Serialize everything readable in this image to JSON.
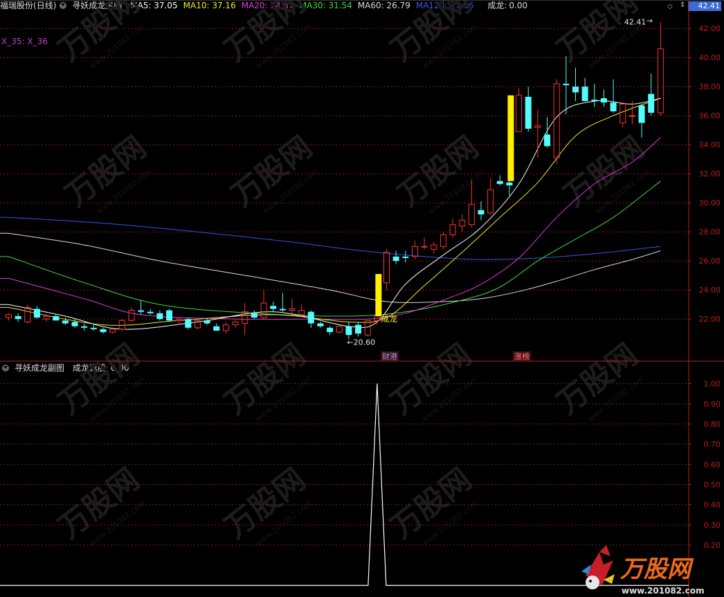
{
  "header": {
    "stock": "福瑞股份",
    "period": "(日线)",
    "indicator": "寻妖成龙主图",
    "ma": [
      {
        "label": "MA5:",
        "value": "37.05",
        "color": "#ffffff"
      },
      {
        "label": "MA10:",
        "value": "37.16",
        "color": "#f2ea2c"
      },
      {
        "label": "MA20:",
        "value": "34.57",
        "color": "#e03ae0"
      },
      {
        "label": "MA30:",
        "value": "31.54",
        "color": "#3edc3e"
      },
      {
        "label": "MA60:",
        "value": "26.79",
        "color": "#dddddd"
      },
      {
        "label": "MA120:",
        "value": "27.06",
        "color": "#3a54e6"
      }
    ],
    "signal_label": "成龙:",
    "signal_value": "0.00",
    "current_price": "42.41"
  },
  "x_label": "X_35: X_36",
  "sub_header": {
    "indicator": "寻妖成龙副图",
    "label": "成龙选股:",
    "value": "0.00"
  },
  "watermark": {
    "logo_text": "万股网",
    "url_text": "www.201082.com"
  },
  "colors": {
    "up": "#ff3232",
    "down": "#54fcfc",
    "signal_bar": "#fff000",
    "ma5": "#ffffff",
    "ma10": "#f2ea2c",
    "ma20": "#e03ae0",
    "ma30": "#3edc3e",
    "ma60": "#dddddd",
    "ma120": "#3a54e6",
    "axis": "#c21b1b",
    "grid": "#8b1a1a"
  },
  "chart_data": [
    {
      "type": "candlestick",
      "title": "寻妖成龙主图",
      "y_axis_ticks": [
        22,
        24,
        26,
        28,
        30,
        32,
        34,
        36,
        38,
        40,
        42
      ],
      "ylim": [
        19.2,
        43.2
      ],
      "grid": true,
      "ohlc": [
        [
          22.1,
          22.4,
          21.9,
          22.3
        ],
        [
          22.2,
          22.4,
          21.8,
          22.0
        ],
        [
          21.8,
          23.0,
          21.7,
          22.8
        ],
        [
          22.7,
          22.9,
          22.0,
          22.1
        ],
        [
          22.0,
          22.3,
          21.8,
          22.2
        ],
        [
          22.2,
          22.3,
          21.9,
          21.9
        ],
        [
          21.9,
          22.1,
          21.6,
          21.7
        ],
        [
          21.8,
          22.0,
          21.4,
          21.5
        ],
        [
          21.5,
          21.7,
          21.2,
          21.4
        ],
        [
          21.4,
          21.6,
          21.2,
          21.3
        ],
        [
          21.3,
          21.4,
          21.0,
          21.1
        ],
        [
          21.1,
          21.4,
          21.0,
          21.3
        ],
        [
          21.3,
          22.0,
          21.2,
          21.9
        ],
        [
          21.9,
          22.8,
          21.8,
          22.6
        ],
        [
          22.6,
          23.3,
          22.3,
          22.5
        ],
        [
          22.5,
          22.7,
          22.3,
          22.4
        ],
        [
          22.4,
          22.6,
          21.9,
          22.0
        ],
        [
          22.6,
          22.7,
          21.8,
          21.9
        ],
        [
          21.9,
          22.1,
          21.6,
          22.0
        ],
        [
          22.0,
          22.1,
          21.3,
          21.4
        ],
        [
          21.4,
          22.0,
          21.3,
          21.9
        ],
        [
          21.9,
          22.1,
          21.6,
          21.7
        ],
        [
          21.5,
          21.7,
          21.2,
          21.2
        ],
        [
          21.2,
          21.8,
          21.0,
          21.6
        ],
        [
          21.6,
          21.9,
          21.4,
          21.8
        ],
        [
          21.7,
          23.1,
          20.9,
          22.5
        ],
        [
          22.4,
          22.6,
          22.0,
          22.1
        ],
        [
          22.1,
          24.0,
          22.0,
          23.1
        ],
        [
          22.9,
          23.2,
          22.5,
          22.7
        ],
        [
          22.7,
          23.8,
          22.5,
          22.6
        ],
        [
          22.6,
          23.4,
          22.4,
          22.7
        ],
        [
          22.3,
          23.0,
          22.1,
          22.6
        ],
        [
          22.5,
          22.6,
          21.4,
          21.7
        ],
        [
          21.7,
          21.8,
          21.4,
          21.5
        ],
        [
          21.4,
          21.5,
          20.9,
          21.1
        ],
        [
          21.1,
          21.6,
          21.0,
          21.5
        ],
        [
          21.5,
          21.8,
          20.6,
          20.9
        ],
        [
          21.6,
          21.8,
          20.8,
          21.0
        ],
        [
          20.9,
          21.9,
          20.8,
          21.9
        ],
        [
          21.9,
          22.4,
          21.6,
          22.2
        ],
        [
          24.5,
          26.8,
          24.0,
          26.6
        ],
        [
          26.3,
          26.7,
          25.8,
          26.0
        ],
        [
          26.3,
          26.7,
          25.9,
          26.2
        ],
        [
          26.3,
          27.4,
          26.1,
          27.0
        ],
        [
          27.0,
          27.6,
          26.8,
          27.0
        ],
        [
          26.8,
          27.3,
          26.5,
          27.1
        ],
        [
          27.0,
          28.0,
          26.8,
          27.8
        ],
        [
          27.8,
          28.9,
          27.6,
          28.5
        ],
        [
          28.4,
          29.2,
          28.0,
          28.8
        ],
        [
          28.5,
          31.6,
          28.3,
          29.9
        ],
        [
          29.5,
          30.1,
          28.8,
          29.2
        ],
        [
          29.3,
          31.7,
          29.2,
          30.9
        ],
        [
          31.5,
          31.9,
          31.2,
          31.3
        ],
        [
          31.4,
          32.9,
          30.5,
          31.2
        ],
        [
          34.9,
          37.9,
          34.9,
          37.4
        ],
        [
          37.3,
          38.0,
          34.9,
          35.1
        ],
        [
          35.2,
          36.4,
          33.1,
          35.3
        ],
        [
          34.7,
          35.9,
          33.8,
          33.9
        ],
        [
          33.1,
          38.5,
          32.7,
          38.2
        ],
        [
          38.2,
          40.1,
          36.1,
          38.1
        ],
        [
          38.0,
          39.3,
          37.0,
          37.6
        ],
        [
          38.0,
          38.6,
          37.1,
          37.0
        ],
        [
          37.1,
          38.2,
          36.6,
          37.0
        ],
        [
          37.2,
          37.8,
          36.6,
          36.9
        ],
        [
          36.9,
          38.5,
          36.2,
          36.3
        ],
        [
          35.5,
          36.8,
          35.2,
          36.8
        ],
        [
          36.0,
          37.0,
          35.4,
          36.0
        ],
        [
          36.7,
          36.8,
          34.5,
          35.5
        ],
        [
          37.5,
          38.9,
          36.0,
          36.2
        ],
        [
          36.2,
          42.41,
          36.0,
          40.6
        ]
      ],
      "signal_bars": [
        {
          "bar": 39,
          "from": 22.2,
          "to": 25.1
        },
        {
          "bar": 53,
          "from": 31.5,
          "to": 37.4
        }
      ],
      "ma_series": {
        "ma5": {
          "knots": [
            [
              0,
              23.0
            ],
            [
              6,
              22.2
            ],
            [
              12,
              21.3
            ],
            [
              20,
              21.8
            ],
            [
              28,
              22.5
            ],
            [
              36,
              21.5
            ],
            [
              39,
              21.8
            ],
            [
              42,
              24.4
            ],
            [
              46,
              26.4
            ],
            [
              50,
              28.3
            ],
            [
              54,
              31.3
            ],
            [
              58,
              35.9
            ],
            [
              62,
              37.0
            ],
            [
              66,
              36.8
            ],
            [
              69,
              37.2
            ]
          ]
        },
        "ma10": {
          "knots": [
            [
              0,
              22.8
            ],
            [
              10,
              21.6
            ],
            [
              18,
              21.9
            ],
            [
              28,
              22.3
            ],
            [
              36,
              21.8
            ],
            [
              40,
              22.1
            ],
            [
              44,
              24.3
            ],
            [
              48,
              26.6
            ],
            [
              52,
              29.0
            ],
            [
              56,
              31.4
            ],
            [
              60,
              34.6
            ],
            [
              64,
              36.0
            ],
            [
              69,
              37.2
            ]
          ]
        },
        "ma20": {
          "knots": [
            [
              0,
              24.8
            ],
            [
              8,
              23.4
            ],
            [
              14,
              22.3
            ],
            [
              24,
              22.0
            ],
            [
              32,
              22.0
            ],
            [
              38,
              22.0
            ],
            [
              42,
              22.4
            ],
            [
              46,
              23.3
            ],
            [
              50,
              24.4
            ],
            [
              54,
              26.2
            ],
            [
              58,
              29.0
            ],
            [
              62,
              31.3
            ],
            [
              66,
              32.8
            ],
            [
              69,
              34.5
            ]
          ]
        },
        "ma30": {
          "knots": [
            [
              0,
              26.3
            ],
            [
              8,
              24.5
            ],
            [
              16,
              23.0
            ],
            [
              26,
              22.4
            ],
            [
              36,
              22.2
            ],
            [
              42,
              22.5
            ],
            [
              48,
              23.3
            ],
            [
              52,
              24.2
            ],
            [
              56,
              26.0
            ],
            [
              60,
              27.5
            ],
            [
              64,
              29.0
            ],
            [
              69,
              31.5
            ]
          ]
        },
        "ma60": {
          "knots": [
            [
              0,
              27.9
            ],
            [
              8,
              27.1
            ],
            [
              16,
              26.0
            ],
            [
              26,
              24.9
            ],
            [
              34,
              24.0
            ],
            [
              40,
              23.2
            ],
            [
              46,
              23.2
            ],
            [
              50,
              23.4
            ],
            [
              54,
              23.9
            ],
            [
              58,
              24.6
            ],
            [
              62,
              25.4
            ],
            [
              66,
              26.1
            ],
            [
              69,
              26.7
            ]
          ]
        },
        "ma120": {
          "knots": [
            [
              0,
              29.0
            ],
            [
              10,
              28.6
            ],
            [
              20,
              28.0
            ],
            [
              30,
              27.3
            ],
            [
              36,
              26.8
            ],
            [
              44,
              26.3
            ],
            [
              50,
              26.1
            ],
            [
              56,
              26.2
            ],
            [
              62,
              26.5
            ],
            [
              69,
              27.0
            ]
          ]
        }
      },
      "annotations": [
        {
          "text": "20.60",
          "bar": 36,
          "value": 20.6,
          "arrow": "←"
        },
        {
          "text": "42.41",
          "bar": 69,
          "value": 42.41,
          "arrow": "→"
        },
        {
          "text": "成龙",
          "bar": 39,
          "value": 22.0
        }
      ],
      "event_labels": [
        {
          "text": "财港",
          "bar": 40
        },
        {
          "text": "涨榜",
          "bar": 54
        }
      ]
    },
    {
      "type": "line",
      "title": "寻妖成龙副图",
      "series": [
        {
          "name": "成龙选股",
          "peak_bar": 39,
          "peak_value": 1.0,
          "baseline": 0.0
        }
      ],
      "y_axis_ticks": [
        0.2,
        0.3,
        0.4,
        0.5,
        0.6,
        0.7,
        0.8,
        0.9,
        1.0
      ],
      "y_tick_labels": [
        "0.20",
        "0.30",
        "0.40",
        "0.50",
        "0.60",
        "0.70",
        "0.80",
        "0.90",
        "1.00"
      ],
      "ylim": [
        -0.03,
        1.05
      ]
    }
  ]
}
